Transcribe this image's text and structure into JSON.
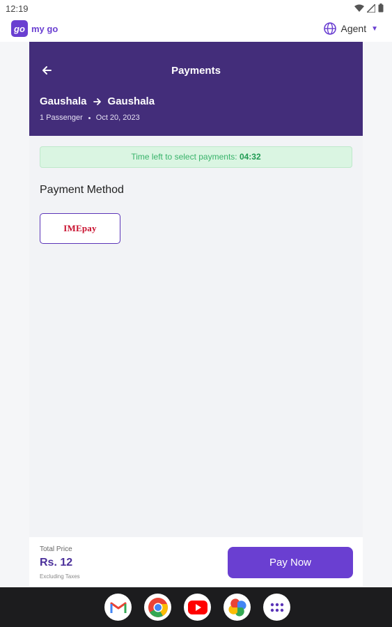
{
  "status_bar": {
    "time": "12:19"
  },
  "app_bar": {
    "logo_mark": "go",
    "app_name": "my go",
    "account_label": "Agent"
  },
  "header": {
    "title": "Payments",
    "origin": "Gaushala",
    "destination": "Gaushala",
    "passengers": "1 Passenger",
    "date": "Oct 20, 2023"
  },
  "timer": {
    "label": "Time left to select payments:",
    "value": "04:32"
  },
  "payment_methods": {
    "title": "Payment Method",
    "options": [
      {
        "label": "IMEpay",
        "icon": "imepay-logo"
      }
    ]
  },
  "footer": {
    "total_label": "Total Price",
    "total_value": "Rs. 12",
    "tax_note": "Excluding Taxes",
    "pay_button": "Pay Now"
  },
  "dock": {
    "apps": [
      "gmail-icon",
      "chrome-icon",
      "youtube-icon",
      "photos-icon",
      "app-drawer-icon"
    ]
  },
  "colors": {
    "brand": "#6a3fd1",
    "header_bg": "#432d7a",
    "timer_bg": "#daf5e2",
    "timer_text": "#38b36a"
  }
}
